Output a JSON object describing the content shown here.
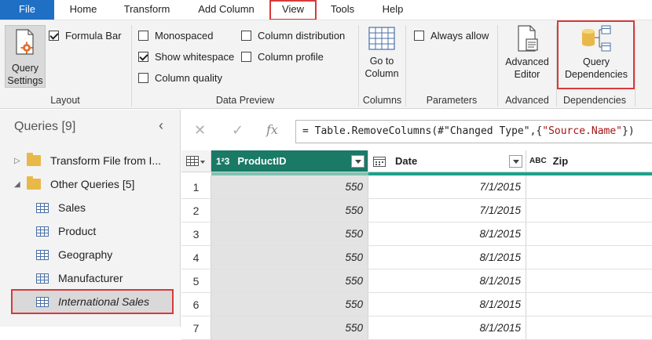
{
  "tabs": [
    "File",
    "Home",
    "Transform",
    "Add Column",
    "View",
    "Tools",
    "Help"
  ],
  "ribbon": {
    "layout": {
      "query_settings_line1": "Query",
      "query_settings_line2": "Settings",
      "formula_bar": "Formula Bar",
      "formula_bar_checked": true,
      "group_label": "Layout"
    },
    "data_preview": {
      "monospaced": "Monospaced",
      "show_whitespace": "Show whitespace",
      "column_quality": "Column quality",
      "column_distribution": "Column distribution",
      "column_profile": "Column profile",
      "group_label": "Data Preview"
    },
    "columns": {
      "go_to_line1": "Go to",
      "go_to_line2": "Column",
      "group_label": "Columns"
    },
    "parameters": {
      "always_allow": "Always allow",
      "group_label": "Parameters"
    },
    "advanced": {
      "editor_line1": "Advanced",
      "editor_line2": "Editor",
      "group_label": "Advanced"
    },
    "dependencies": {
      "btn_line1": "Query",
      "btn_line2": "Dependencies",
      "group_label": "Dependencies"
    }
  },
  "queries": {
    "title": "Queries [9]",
    "items": [
      {
        "label": "Transform File from I...",
        "type": "folder",
        "expanded": false
      },
      {
        "label": "Other Queries [5]",
        "type": "folder",
        "expanded": true
      },
      {
        "label": "Sales",
        "type": "table"
      },
      {
        "label": "Product",
        "type": "table"
      },
      {
        "label": "Geography",
        "type": "table"
      },
      {
        "label": "Manufacturer",
        "type": "table"
      },
      {
        "label": "International Sales",
        "type": "table",
        "selected": true
      }
    ]
  },
  "formula": {
    "prefix": "= Table.RemoveColumns(#\"Changed Type\",{",
    "string": "\"Source.Name\"",
    "suffix": "})"
  },
  "grid": {
    "columns": [
      {
        "type_icon": "1²3",
        "name": "ProductID"
      },
      {
        "type_icon": "calendar",
        "name": "Date"
      },
      {
        "type_icon": "ABC",
        "name": "Zip"
      }
    ],
    "rows": [
      {
        "n": "1",
        "productid": "550",
        "date": "7/1/2015"
      },
      {
        "n": "2",
        "productid": "550",
        "date": "7/1/2015"
      },
      {
        "n": "3",
        "productid": "550",
        "date": "8/1/2015"
      },
      {
        "n": "4",
        "productid": "550",
        "date": "8/1/2015"
      },
      {
        "n": "5",
        "productid": "550",
        "date": "8/1/2015"
      },
      {
        "n": "6",
        "productid": "550",
        "date": "8/1/2015"
      },
      {
        "n": "7",
        "productid": "550",
        "date": "8/1/2015"
      }
    ]
  },
  "colors": {
    "file_tab": "#1f6fc5",
    "selected_header": "#1a7a66",
    "highlight_red": "#d9393b",
    "folder": "#e8b948"
  }
}
